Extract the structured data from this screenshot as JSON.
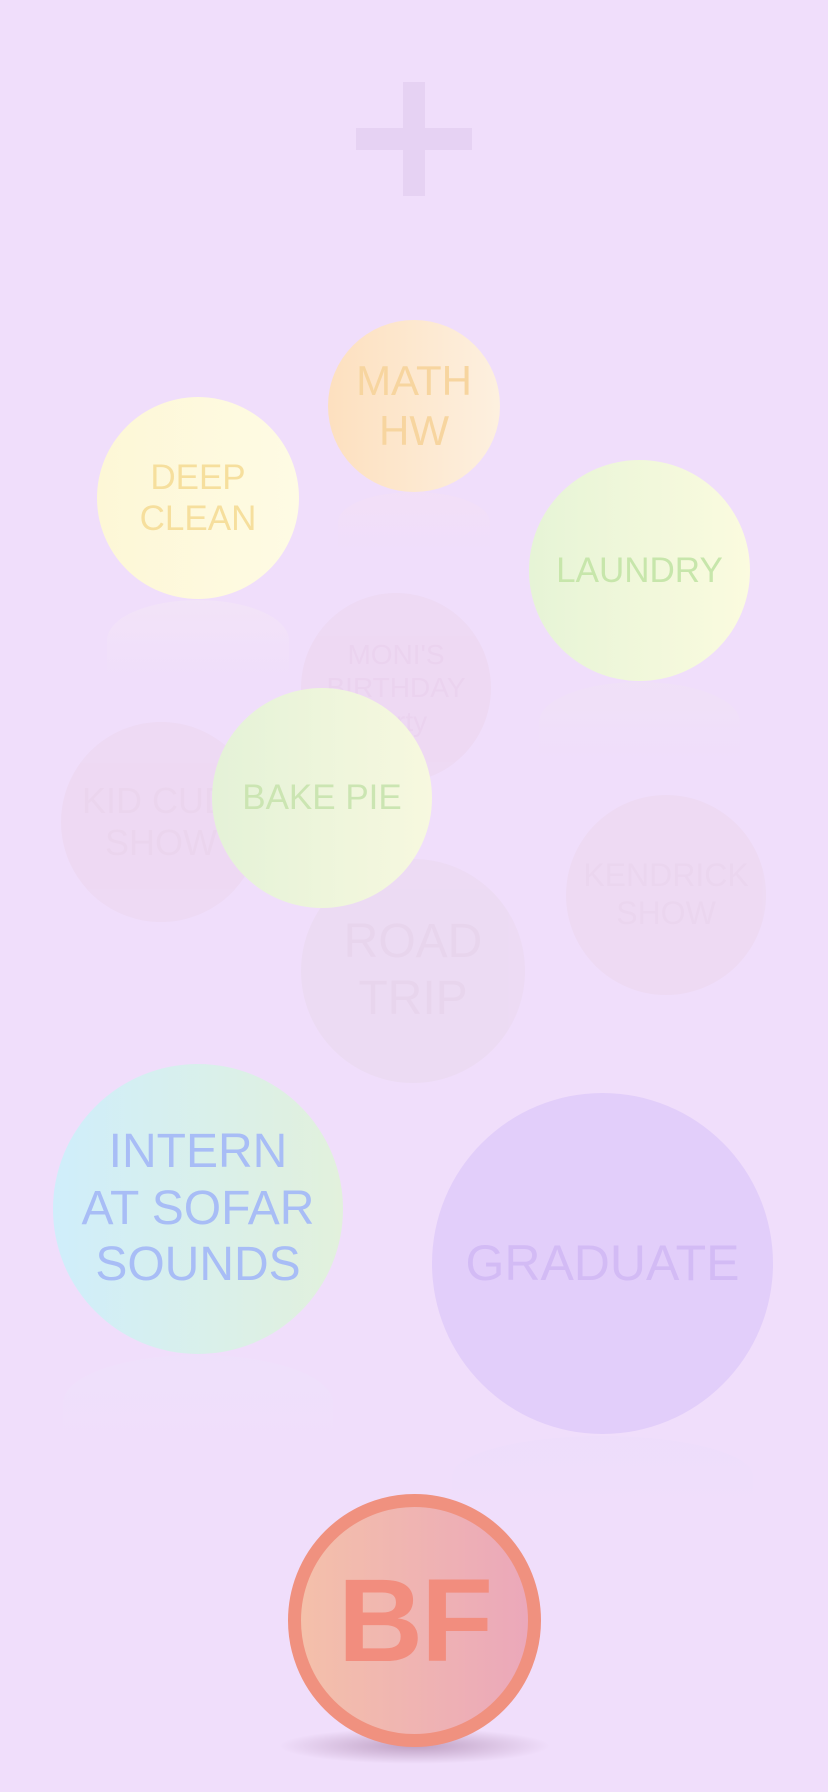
{
  "add_button": {
    "icon": "plus-icon",
    "color": "#e6d2f3"
  },
  "bubbles": {
    "math_hw": "MATH\nHW",
    "deep_clean": "DEEP\nCLEAN",
    "laundry": "LAUNDRY",
    "monis_birthday": "MONI'S\nBIRTHDAY\nparty",
    "kid_cudi_show": "KID CUDI\nSHOW",
    "bake_pie": "BAKE PIE",
    "kendrick_show": "KENDRICK\nSHOW",
    "road_trip": "ROAD\nTRIP",
    "intern": "INTERN\nAT SOFAR\nSOUNDS",
    "graduate": "GRADUATE"
  },
  "profile": {
    "initials": "BF",
    "ring_color": "#f0917f"
  },
  "colors": {
    "background": "#f0defb"
  }
}
